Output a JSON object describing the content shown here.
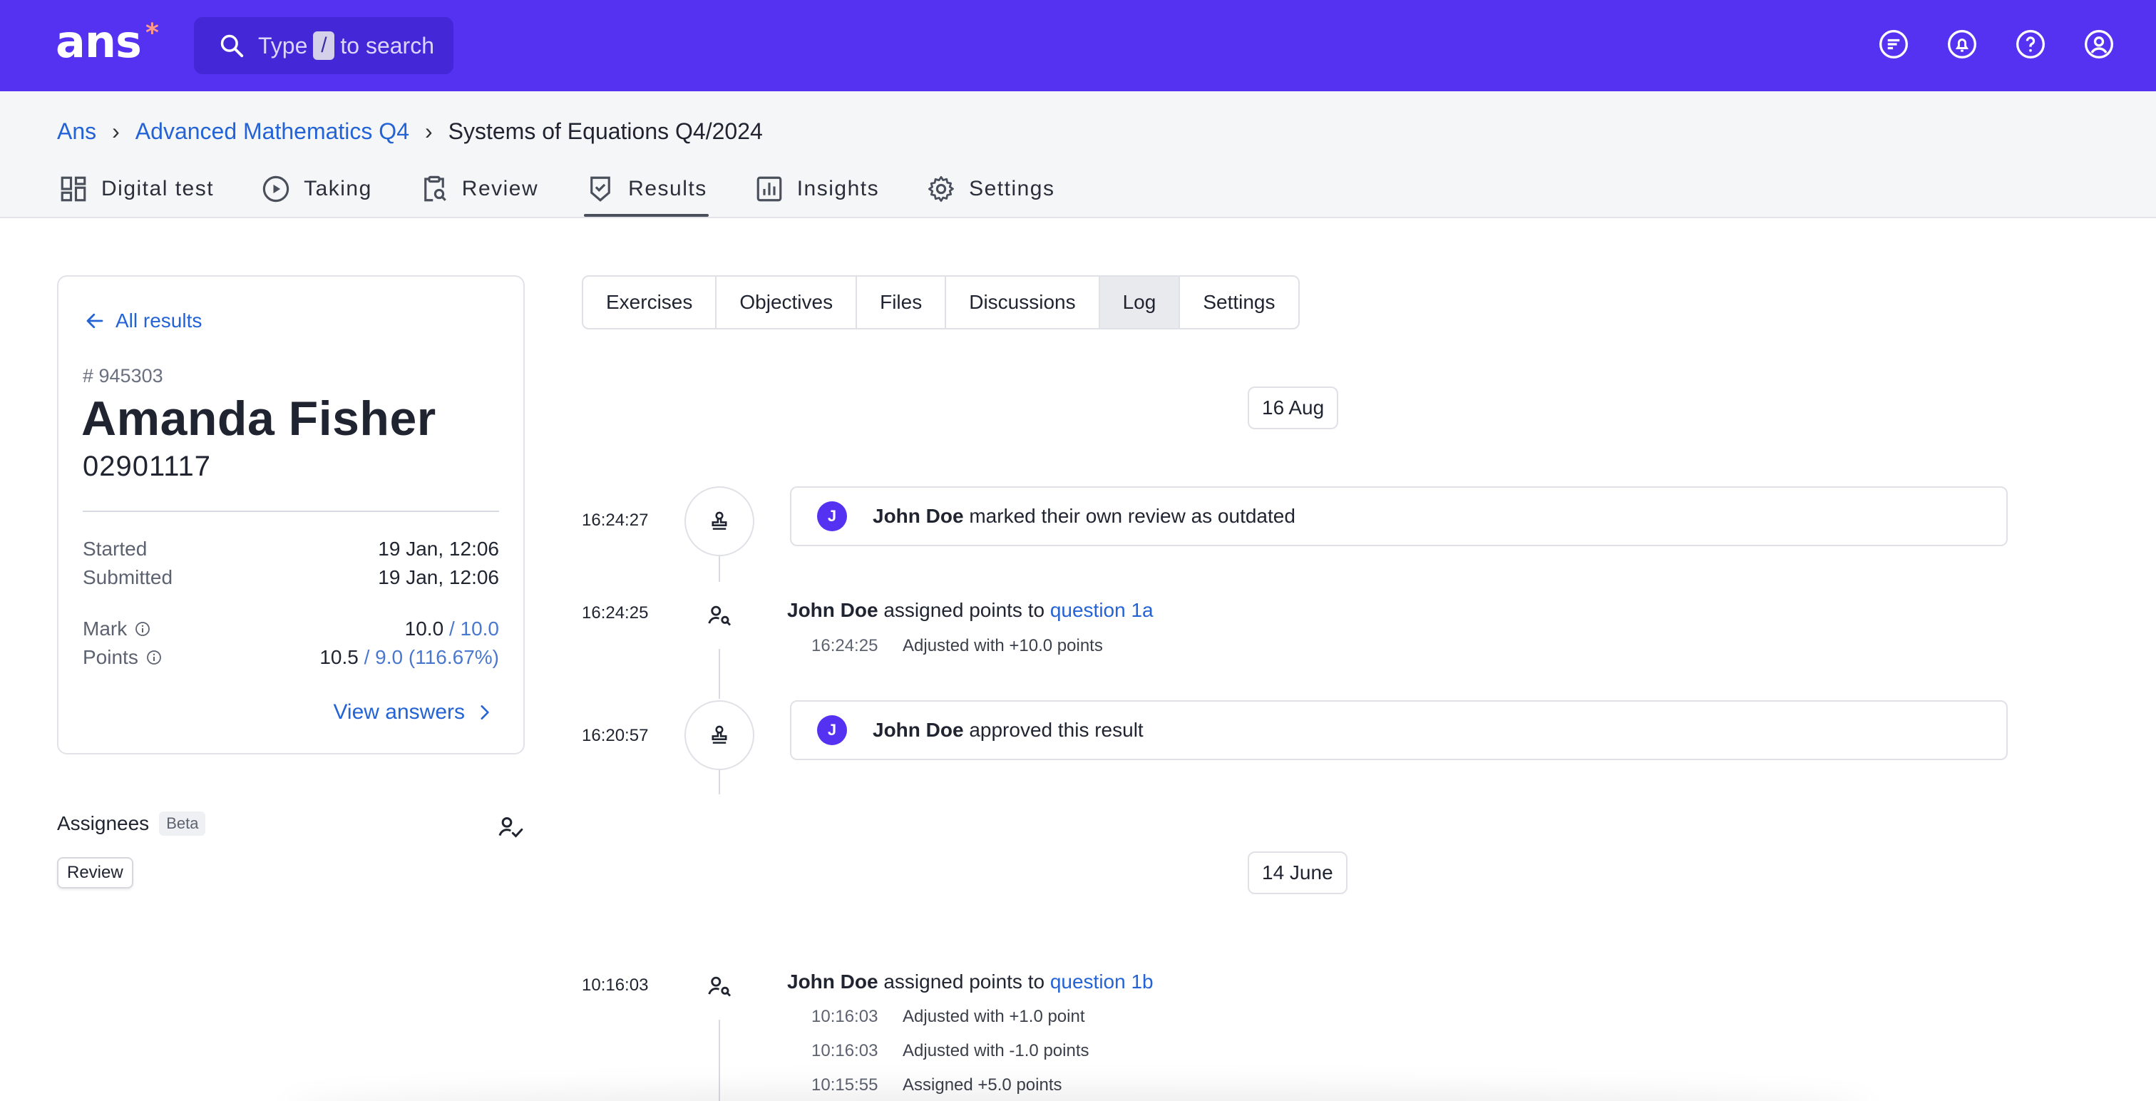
{
  "app": {
    "logo_text": "ans",
    "logo_star": "*"
  },
  "search": {
    "prefix": "Type",
    "key": "/",
    "suffix": "to search"
  },
  "top_icons": [
    "feed-icon",
    "bell-icon",
    "help-icon",
    "account-icon"
  ],
  "breadcrumb": {
    "root": "Ans",
    "course": "Advanced Mathematics Q4",
    "current": "Systems of Equations Q4/2024"
  },
  "nav_tabs": [
    {
      "label": "Digital test",
      "icon": "dashboard-icon"
    },
    {
      "label": "Taking",
      "icon": "play-circle-icon"
    },
    {
      "label": "Review",
      "icon": "clipboard-search-icon"
    },
    {
      "label": "Results",
      "icon": "shield-check-icon",
      "active": true
    },
    {
      "label": "Insights",
      "icon": "bar-chart-icon"
    },
    {
      "label": "Settings",
      "icon": "gear-icon"
    }
  ],
  "result": {
    "back_label": "All results",
    "id": "# 945303",
    "name": "Amanda Fisher",
    "student_number": "02901117",
    "started_label": "Started",
    "started_value": "19 Jan, 12:06",
    "submitted_label": "Submitted",
    "submitted_value": "19 Jan, 12:06",
    "mark_label": "Mark",
    "mark_value": "10.0",
    "mark_max": "/ 10.0",
    "points_label": "Points",
    "points_value": "10.5",
    "points_max": "/ 9.0 (116.67%)",
    "view_answers": "View answers"
  },
  "assignees": {
    "label": "Assignees",
    "badge": "Beta",
    "chip": "Review"
  },
  "sub_tabs": [
    "Exercises",
    "Objectives",
    "Files",
    "Discussions",
    "Log",
    "Settings"
  ],
  "active_sub_tab": "Log",
  "log": {
    "date1": "16 Aug",
    "date2": "14 June",
    "e1": {
      "time": "16:24:27",
      "avatar": "J",
      "actor": "John Doe",
      "text": "marked their own review as outdated"
    },
    "e2": {
      "time": "16:24:25",
      "actor": "John Doe",
      "text": "assigned points to",
      "link": "question 1a",
      "details": [
        {
          "time": "16:24:25",
          "text": "Adjusted with +10.0 points"
        }
      ]
    },
    "e3": {
      "time": "16:20:57",
      "avatar": "J",
      "actor": "John Doe",
      "text": "approved this result"
    },
    "e4": {
      "time": "10:16:03",
      "actor": "John Doe",
      "text": "assigned points to",
      "link": "question 1b",
      "details": [
        {
          "time": "10:16:03",
          "text": "Adjusted with +1.0 point"
        },
        {
          "time": "10:16:03",
          "text": "Adjusted with -1.0 points"
        },
        {
          "time": "10:15:55",
          "text": "Assigned +5.0 points"
        }
      ]
    }
  },
  "colors": {
    "brand": "#5531f2",
    "link": "#2463d6"
  }
}
